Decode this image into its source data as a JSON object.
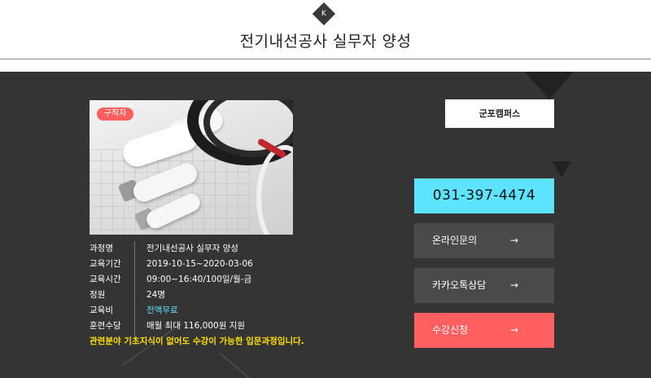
{
  "header": {
    "logo_letter": "K",
    "title": "전기내선공사 실무자 양성"
  },
  "course": {
    "badge": "구직자",
    "image_icon": "electric-supplies-photo",
    "info": [
      {
        "label": "과정명",
        "value": "전기내선공사 실무자 양성"
      },
      {
        "label": "교육기간",
        "value": "2019-10-15~2020-03-06"
      },
      {
        "label": "교육시간",
        "value": "09:00~16:40/100일/월-금"
      },
      {
        "label": "정원",
        "value": "24명"
      },
      {
        "label": "교육비",
        "value": "전액무료"
      },
      {
        "label": "훈련수당",
        "value": "매월 최대 116,000원 지원"
      }
    ],
    "notice": "관련분야 기초지식이 없어도 수강이 가능한 입문과정입니다."
  },
  "sidebar": {
    "campus_label": "군포캠퍼스",
    "phone": "031-397-4474",
    "buttons": [
      {
        "label": "온라인문의",
        "arrow": "→"
      },
      {
        "label": "카카오톡상담",
        "arrow": "→"
      },
      {
        "label": "수강신청",
        "arrow": "→"
      }
    ]
  },
  "colors": {
    "panel_bg": "#343434",
    "accent_cyan": "#5ee3ff",
    "accent_red": "#ff5f5f",
    "notice_yellow": "#ffe000",
    "button_grey": "#4a4a4a"
  }
}
